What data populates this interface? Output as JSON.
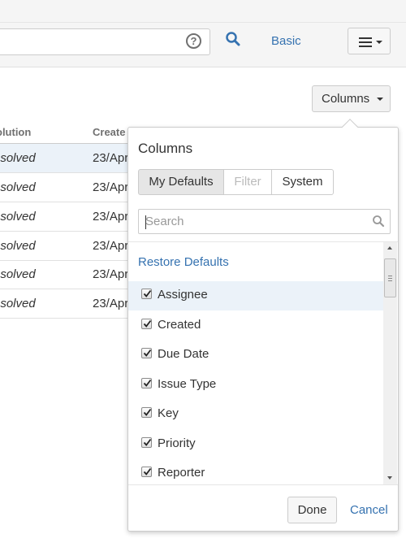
{
  "toolbar": {
    "help_glyph": "?",
    "basic_label": "Basic"
  },
  "columns_button_label": "Columns",
  "table": {
    "headers": [
      "olution",
      "Create"
    ],
    "rows": [
      {
        "resolution": "esolved",
        "created": "23/Apr",
        "highlight": true
      },
      {
        "resolution": "esolved",
        "created": "23/Apr"
      },
      {
        "resolution": "esolved",
        "created": "23/Apr"
      },
      {
        "resolution": "esolved",
        "created": "23/Apr"
      },
      {
        "resolution": "esolved",
        "created": "23/Apr"
      },
      {
        "resolution": "esolved",
        "created": "23/Apr"
      }
    ]
  },
  "popup": {
    "title": "Columns",
    "tabs": [
      {
        "label": "My Defaults",
        "state": "active"
      },
      {
        "label": "Filter",
        "state": "disabled"
      },
      {
        "label": "System",
        "state": "normal"
      }
    ],
    "search_placeholder": "Search",
    "restore_label": "Restore Defaults",
    "columns": [
      {
        "label": "Assignee",
        "checked": true
      },
      {
        "label": "Created",
        "checked": true
      },
      {
        "label": "Due Date",
        "checked": true
      },
      {
        "label": "Issue Type",
        "checked": true
      },
      {
        "label": "Key",
        "checked": true
      },
      {
        "label": "Priority",
        "checked": true
      },
      {
        "label": "Reporter",
        "checked": true
      }
    ],
    "done_label": "Done",
    "cancel_label": "Cancel"
  },
  "colors": {
    "link": "#3572b0",
    "highlight": "#ebf2f9"
  }
}
